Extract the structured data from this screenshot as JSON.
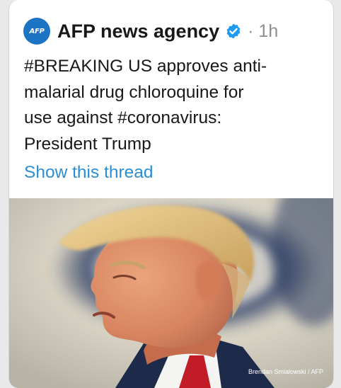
{
  "account": {
    "name": "AFP news agency",
    "avatar_text": "AFP",
    "separator": "·",
    "time": "1h"
  },
  "tweet": {
    "lines": [
      "#BREAKING US approves anti-",
      "malarial drug chloroquine for",
      "use against #coronavirus:",
      "President Trump"
    ],
    "show_thread": "Show this thread"
  },
  "media": {
    "credit": "Brendan Smialowski / AFP"
  },
  "colors": {
    "link": "#2b8ed4",
    "verified": "#1d9bf0",
    "avatar": "#1d73c4",
    "text": "#16181a",
    "muted": "#8a8f94"
  },
  "icons": {
    "verified": "verified-badge-icon",
    "avatar": "afp-logo"
  }
}
